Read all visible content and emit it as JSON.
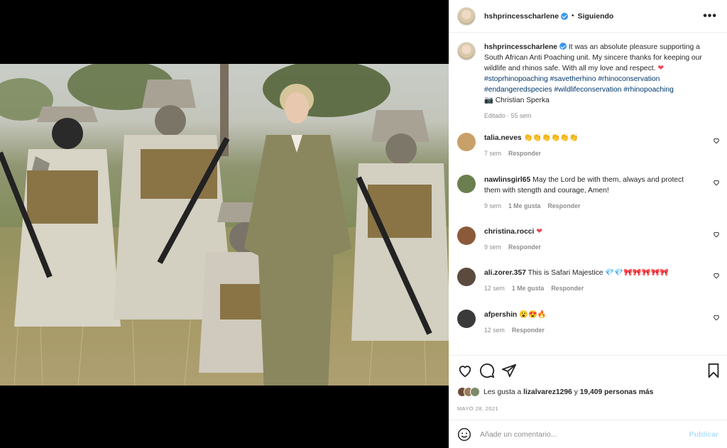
{
  "post": {
    "username": "hshprincesscharlene",
    "follow_status": "Siguiendo",
    "more_label": "•••",
    "caption": {
      "text_1": "It was an absolute pleasure supporting a South African Anti Poaching unit. My sincere thanks for keeping our wildlife and rhinos safe. With all my love and respect.",
      "heart": "❤",
      "hashtags": [
        "#stoprhinopoaching",
        "#savetherhino",
        "#rhinoconservation",
        "#endangeredspecies",
        "#wildlifeconservation",
        "#rhinopoaching"
      ],
      "credit_icon": "📷",
      "credit": "Christian Sperka",
      "meta": "Editado · 55 sem"
    }
  },
  "comments": [
    {
      "user": "talia.neves",
      "text": "👏👏👏👏👏👏",
      "time": "7 sem",
      "likes": "",
      "reply": "Responder",
      "avatar_color": "#c8a06a"
    },
    {
      "user": "nawlinsgirl65",
      "text": "May the Lord be with them, always and protect them with stength and courage, Amen!",
      "time": "9 sem",
      "likes": "1 Me gusta",
      "reply": "Responder",
      "avatar_color": "#6b7f4e"
    },
    {
      "user": "christina.rocci",
      "text": "❤",
      "time": "9 sem",
      "likes": "",
      "reply": "Responder",
      "avatar_color": "#8a5a3a"
    },
    {
      "user": "ali.zorer.357",
      "text": "This is Safari Majestice 💎💎🎀🎀🎀🎀🎀",
      "time": "12 sem",
      "likes": "1 Me gusta",
      "reply": "Responder",
      "avatar_color": "#5b4a3e"
    },
    {
      "user": "afpershin",
      "text": "😮😍🔥",
      "time": "12 sem",
      "likes": "",
      "reply": "Responder",
      "avatar_color": "#3a3a3a"
    }
  ],
  "actions": {
    "likes_prefix": "Les gusta a",
    "likes_user": "lizalvarez1296",
    "likes_mid": "y",
    "likes_count": "19,409 personas más",
    "date": "MAYO 28, 2021"
  },
  "composer": {
    "placeholder": "Añade un comentario...",
    "publish": "Publicar"
  },
  "icons": {
    "like": "heart-outline-icon",
    "comment": "comment-bubble-icon",
    "share": "paper-plane-icon",
    "save": "bookmark-icon",
    "emoji": "smiley-icon",
    "verified": "verified-badge-icon"
  },
  "colors": {
    "link": "#00376b",
    "muted": "#8e8e8e",
    "accent": "#3897f0",
    "publish_disabled": "#b2dffc",
    "heart": "#ed4956"
  }
}
